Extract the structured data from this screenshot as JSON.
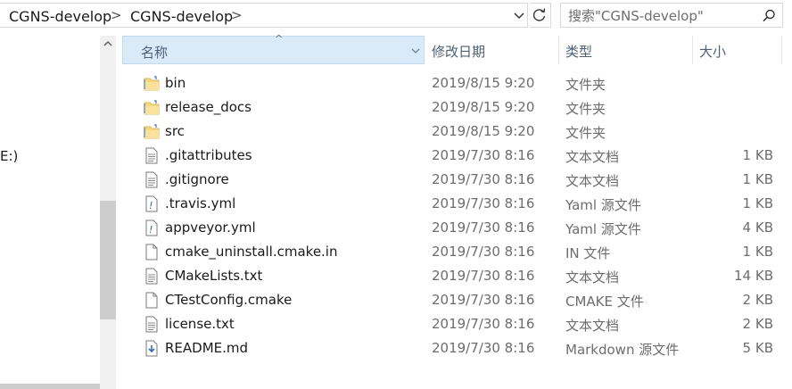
{
  "address": {
    "crumbs": [
      "CGNS-develop",
      "CGNS-develop"
    ],
    "separator": ">"
  },
  "search": {
    "placeholder": "搜索\"CGNS-develop\""
  },
  "navpane": {
    "fragment_text": "E:)"
  },
  "columns": {
    "name": "名称",
    "date": "修改日期",
    "type": "类型",
    "size": "大小",
    "sort_indicator": "^"
  },
  "files": [
    {
      "icon": "folder-icon",
      "name": "bin",
      "date": "2019/8/15 9:20",
      "type": "文件夹",
      "size": ""
    },
    {
      "icon": "folder-icon",
      "name": "release_docs",
      "date": "2019/8/15 9:20",
      "type": "文件夹",
      "size": ""
    },
    {
      "icon": "folder-icon",
      "name": "src",
      "date": "2019/8/15 9:20",
      "type": "文件夹",
      "size": ""
    },
    {
      "icon": "text-file-icon",
      "name": ".gitattributes",
      "date": "2019/7/30 8:16",
      "type": "文本文档",
      "size": "1 KB"
    },
    {
      "icon": "text-file-icon",
      "name": ".gitignore",
      "date": "2019/7/30 8:16",
      "type": "文本文档",
      "size": "1 KB"
    },
    {
      "icon": "yaml-file-icon",
      "name": ".travis.yml",
      "date": "2019/7/30 8:16",
      "type": "Yaml 源文件",
      "size": "1 KB"
    },
    {
      "icon": "yaml-file-icon",
      "name": "appveyor.yml",
      "date": "2019/7/30 8:16",
      "type": "Yaml 源文件",
      "size": "4 KB"
    },
    {
      "icon": "generic-file-icon",
      "name": "cmake_uninstall.cmake.in",
      "date": "2019/7/30 8:16",
      "type": "IN 文件",
      "size": "1 KB"
    },
    {
      "icon": "text-file-icon",
      "name": "CMakeLists.txt",
      "date": "2019/7/30 8:16",
      "type": "文本文档",
      "size": "14 KB"
    },
    {
      "icon": "generic-file-icon",
      "name": "CTestConfig.cmake",
      "date": "2019/7/30 8:16",
      "type": "CMAKE 文件",
      "size": "2 KB"
    },
    {
      "icon": "text-file-icon",
      "name": "license.txt",
      "date": "2019/7/30 8:16",
      "type": "文本文档",
      "size": "2 KB"
    },
    {
      "icon": "markdown-file-icon",
      "name": "README.md",
      "date": "2019/7/30 8:16",
      "type": "Markdown 源文件",
      "size": "5 KB"
    }
  ],
  "colors": {
    "header_highlight": "#d9ebf9",
    "folder": "#f8d775",
    "muted_text": "#6d6d6d"
  }
}
